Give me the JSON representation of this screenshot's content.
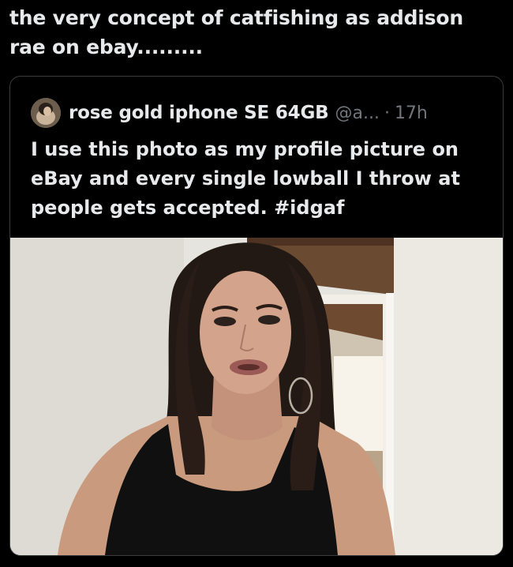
{
  "post": {
    "text": "the very concept of catfishing as addison rae on ebay........."
  },
  "quoted": {
    "author_name": "rose gold iphone SE 64GB",
    "handle": "@a...",
    "separator": "·",
    "time": "17h",
    "text": "I use this photo as my profile picture on eBay and every single lowball I throw at people gets accepted. #idgaf"
  },
  "icons": {
    "avatar": "avatar-photo",
    "media": "photo-of-woman-in-room"
  },
  "colors": {
    "background": "#000000",
    "text_primary": "#e7e9ea",
    "text_secondary": "#71767b",
    "card_border": "#3a3d40"
  }
}
